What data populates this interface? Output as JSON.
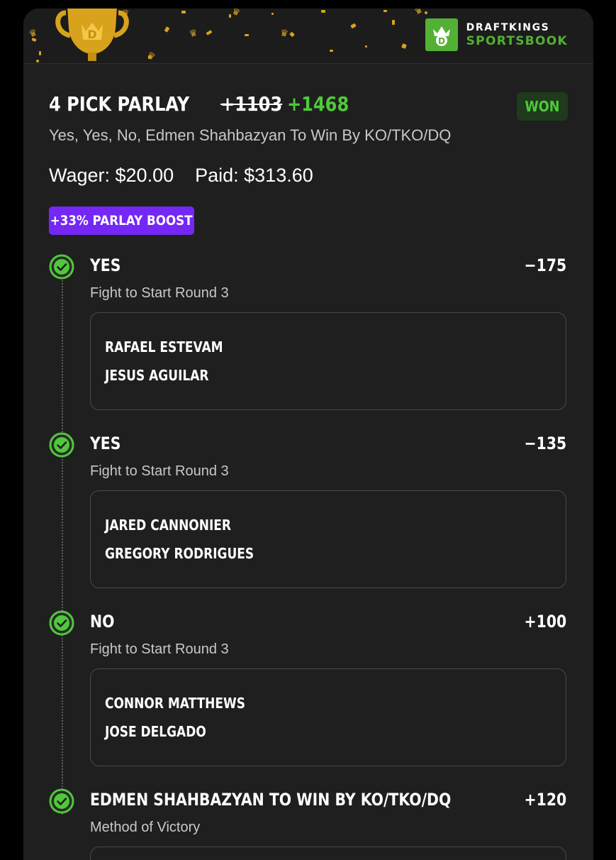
{
  "brand": {
    "top": "DRAFTKINGS",
    "bottom": "SPORTSBOOK",
    "accent": "#53b035"
  },
  "bet": {
    "title": "4 PICK PARLAY",
    "odds_original": "+1103",
    "odds_boosted": "+1468",
    "status": "WON",
    "selections_summary": "Yes, Yes, No, Edmen Shahbazyan To Win By KO/TKO/DQ",
    "wager_label": "Wager: $20.00",
    "paid_label": "Paid: $313.60",
    "boost_label": "+33% PARLAY BOOST"
  },
  "legs": [
    {
      "pick": "YES",
      "odds": "−175",
      "market": "Fight to Start Round 3",
      "team1": "RAFAEL ESTEVAM",
      "team2": "JESUS AGUILAR"
    },
    {
      "pick": "YES",
      "odds": "−135",
      "market": "Fight to Start Round 3",
      "team1": "JARED CANNONIER",
      "team2": "GREGORY RODRIGUES"
    },
    {
      "pick": "NO",
      "odds": "+100",
      "market": "Fight to Start Round 3",
      "team1": "CONNOR MATTHEWS",
      "team2": "JOSE DELGADO"
    },
    {
      "pick": "EDMEN SHAHBAZYAN TO WIN BY KO/TKO/DQ",
      "odds": "+120",
      "market": "Method of Victory"
    }
  ],
  "colors": {
    "win_green": "#4fc93a",
    "boost_purple": "#7427f5",
    "trophy_gold": "#d8a21c"
  },
  "icons": {
    "trophy": "trophy-icon",
    "logo": "draftkings-crown-icon",
    "leg_status": "check-circle-icon"
  }
}
